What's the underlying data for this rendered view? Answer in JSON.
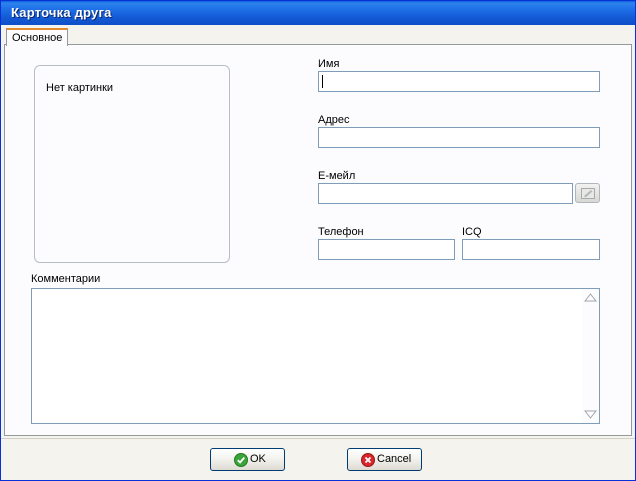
{
  "window": {
    "title": "Карточка друга"
  },
  "tabs": [
    {
      "label": "Основное",
      "selected": true
    }
  ],
  "photo": {
    "placeholder_text": "Нет картинки"
  },
  "fields": {
    "name": {
      "label": "Имя",
      "value": ""
    },
    "address": {
      "label": "Адрес",
      "value": ""
    },
    "email": {
      "label": "E-мейл",
      "value": ""
    },
    "phone": {
      "label": "Телефон",
      "value": ""
    },
    "icq": {
      "label": "ICQ",
      "value": ""
    },
    "comments": {
      "label": "Комментарии",
      "value": ""
    }
  },
  "buttons": {
    "ok": {
      "label": "OK",
      "icon": "check-icon",
      "icon_color": "#3aa33a"
    },
    "cancel": {
      "label": "Cancel",
      "icon": "cross-icon",
      "icon_color": "#d8272d"
    },
    "email_action": {
      "icon": "pencil-icon"
    }
  },
  "colors": {
    "titlebar": "#1459d4",
    "tab_highlight": "#e68b2c",
    "field_border": "#7f9db9",
    "button_border": "#003c74"
  }
}
